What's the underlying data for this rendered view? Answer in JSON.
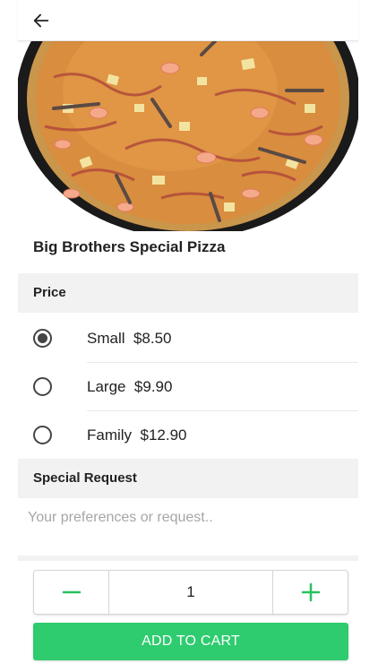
{
  "product": {
    "name": "Big Brothers Special Pizza",
    "image_icon": "pizza-photo"
  },
  "price_section": {
    "header": "Price",
    "options": [
      {
        "label": "Small  $8.50",
        "selected": true
      },
      {
        "label": "Large  $9.90",
        "selected": false
      },
      {
        "label": "Family  $12.90",
        "selected": false
      }
    ]
  },
  "special_request": {
    "header": "Special Request",
    "value": "",
    "placeholder": "Your preferences or request.."
  },
  "quantity": {
    "value": "1",
    "minus_icon": "minus-icon",
    "plus_icon": "plus-icon"
  },
  "cart": {
    "add_label": "ADD TO CART"
  },
  "nav": {
    "back_icon": "arrow-left-icon"
  },
  "colors": {
    "accent_green": "#2ecc6f",
    "stepper_green": "#27c25f",
    "section_bg": "#f2f2f2"
  }
}
